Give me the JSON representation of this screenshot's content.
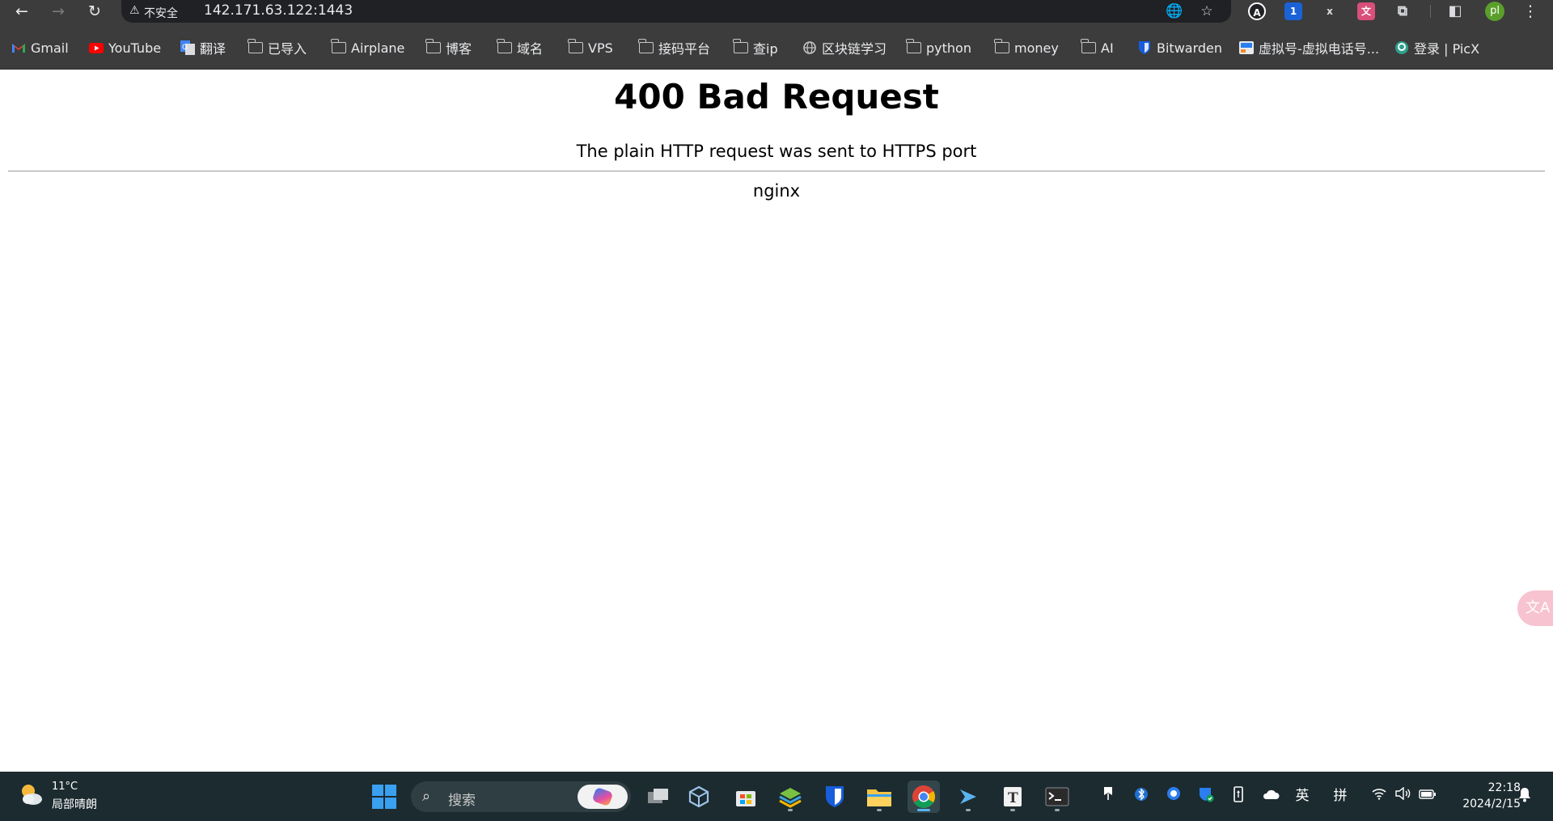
{
  "browser": {
    "nav": {
      "back_icon": "←",
      "forward_icon": "→",
      "reload_icon": "↻"
    },
    "omnibox": {
      "warning_icon": "⚠",
      "security_label": "不安全",
      "url": "142.171.63.122:1443",
      "translate_icon": "🌐",
      "star_icon": "☆"
    },
    "extensions": [
      {
        "name": "extension-1",
        "glyph": "A",
        "color": "#202124"
      },
      {
        "name": "extension-2",
        "glyph": "1",
        "color": "#1a62d6"
      },
      {
        "name": "extension-3",
        "glyph": "x",
        "color": "#3c3c3c"
      },
      {
        "name": "extension-4",
        "glyph": "文",
        "color": "#d94f7a"
      },
      {
        "name": "extensions-puzzle",
        "glyph": "⧉",
        "color": "#3c3c3c"
      }
    ],
    "sidepanel_icon": "◧",
    "profile_initials": "pl",
    "menu_icon": "⋮",
    "bookmarks": [
      {
        "label": "Gmail",
        "icon": "gmail"
      },
      {
        "label": "YouTube",
        "icon": "youtube"
      },
      {
        "label": "翻译",
        "icon": "translate"
      },
      {
        "label": "已导入",
        "icon": "folder"
      },
      {
        "label": "Airplane",
        "icon": "folder"
      },
      {
        "label": "博客",
        "icon": "folder"
      },
      {
        "label": "域名",
        "icon": "folder"
      },
      {
        "label": "VPS",
        "icon": "folder"
      },
      {
        "label": "接码平台",
        "icon": "folder"
      },
      {
        "label": "查ip",
        "icon": "folder"
      },
      {
        "label": "区块链学习",
        "icon": "globe"
      },
      {
        "label": "python",
        "icon": "folder"
      },
      {
        "label": "money",
        "icon": "folder"
      },
      {
        "label": "AI",
        "icon": "folder"
      },
      {
        "label": "Bitwarden",
        "icon": "bitwarden"
      },
      {
        "label": "虚拟号-虚拟电话号...",
        "icon": "site"
      },
      {
        "label": "登录 | PicX",
        "icon": "picx"
      }
    ]
  },
  "page": {
    "heading": "400 Bad Request",
    "message": "The plain HTTP request was sent to HTTPS port",
    "server": "nginx",
    "floating_translate_icon": "文A"
  },
  "taskbar": {
    "weather": {
      "temp": "11°C",
      "desc": "局部晴朗"
    },
    "search_icon": "⌕",
    "search_label": "搜索",
    "tray": {
      "ime_lang": "英",
      "ime_mode": "拼",
      "wifi_icon": "wifi",
      "volume_icon": "🔊",
      "battery_icon": "battery"
    },
    "clock": {
      "time": "22:18",
      "date": "2024/2/15"
    }
  }
}
